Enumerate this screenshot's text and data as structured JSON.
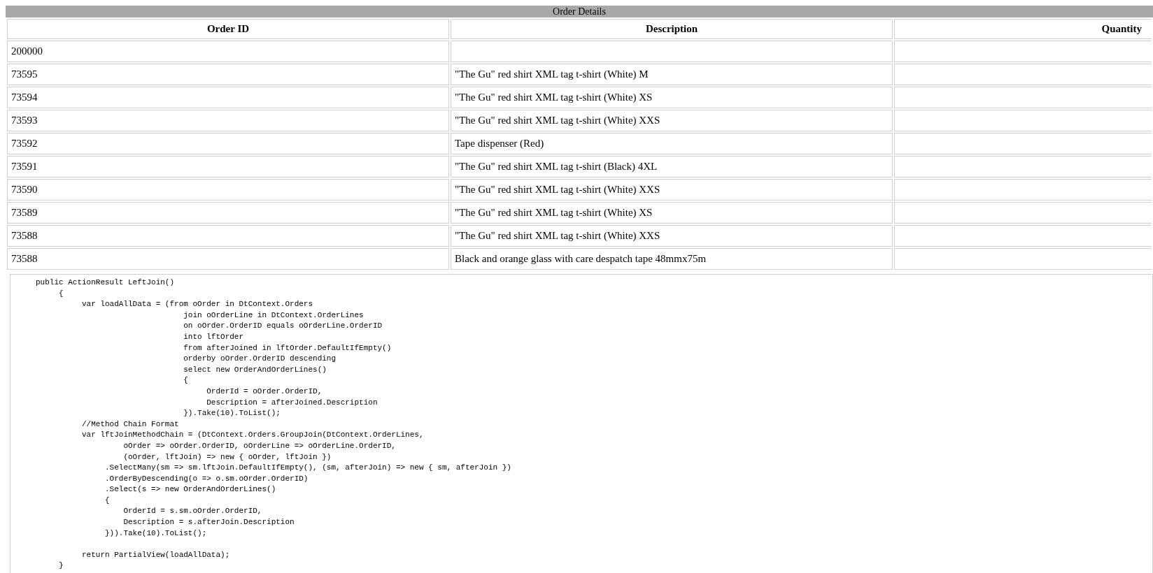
{
  "table": {
    "title": "Order Details",
    "columns": [
      "Order ID",
      "Description",
      "Quantity"
    ],
    "rows": [
      {
        "order_id": "200000",
        "description": ""
      },
      {
        "order_id": "73595",
        "description": "\"The Gu\" red shirt XML tag t-shirt (White) M"
      },
      {
        "order_id": "73594",
        "description": "\"The Gu\" red shirt XML tag t-shirt (White) XS"
      },
      {
        "order_id": "73593",
        "description": "\"The Gu\" red shirt XML tag t-shirt (White) XXS"
      },
      {
        "order_id": "73592",
        "description": "Tape dispenser (Red)"
      },
      {
        "order_id": "73591",
        "description": "\"The Gu\" red shirt XML tag t-shirt (Black) 4XL"
      },
      {
        "order_id": "73590",
        "description": "\"The Gu\" red shirt XML tag t-shirt (White) XXS"
      },
      {
        "order_id": "73589",
        "description": "\"The Gu\" red shirt XML tag t-shirt (White) XS"
      },
      {
        "order_id": "73588",
        "description": "\"The Gu\" red shirt XML tag t-shirt (White) XXS"
      },
      {
        "order_id": "73588",
        "description": "Black and orange glass with care despatch tape 48mmx75m"
      }
    ]
  },
  "code": [
    [
      "public ActionResult LeftJoin()",
      "     {",
      "          var loadAllData = (from oOrder in DtContext.Orders",
      "                                join oOrderLine in DtContext.OrderLines",
      "                                on oOrder.OrderID equals oOrderLine.OrderID",
      "                                into lftOrder",
      "                                from afterJoined in lftOrder.DefaultIfEmpty()",
      "                                orderby oOrder.OrderID descending",
      "                                select new OrderAndOrderLines()",
      "                                {",
      "                                     OrderId = oOrder.OrderID,",
      "                                     Description = afterJoined.Description",
      "                                }).Take(10).ToList();",
      "          //Method Chain Format",
      "          var lftJoinMethodChain = (DtContext.Orders.GroupJoin(DtContext.OrderLines,",
      "                   oOrder => oOrder.OrderID, oOrderLine => oOrderLine.OrderID,",
      "                   (oOrder, lftJoin) => new { oOrder, lftJoin })",
      "               .SelectMany(sm => sm.lftJoin.DefaultIfEmpty(), (sm, afterJoin) => new { sm, afterJoin })",
      "               .OrderByDescending(o => o.sm.oOrder.OrderID)",
      "               .Select(s => new OrderAndOrderLines()",
      "               {",
      "                   OrderId = s.sm.oOrder.OrderID,",
      "                   Description = s.afterJoin.Description",
      "               })).Take(10).ToList();"
    ],
    [
      "          return PartialView(loadAllData);",
      "     }"
    ]
  ]
}
